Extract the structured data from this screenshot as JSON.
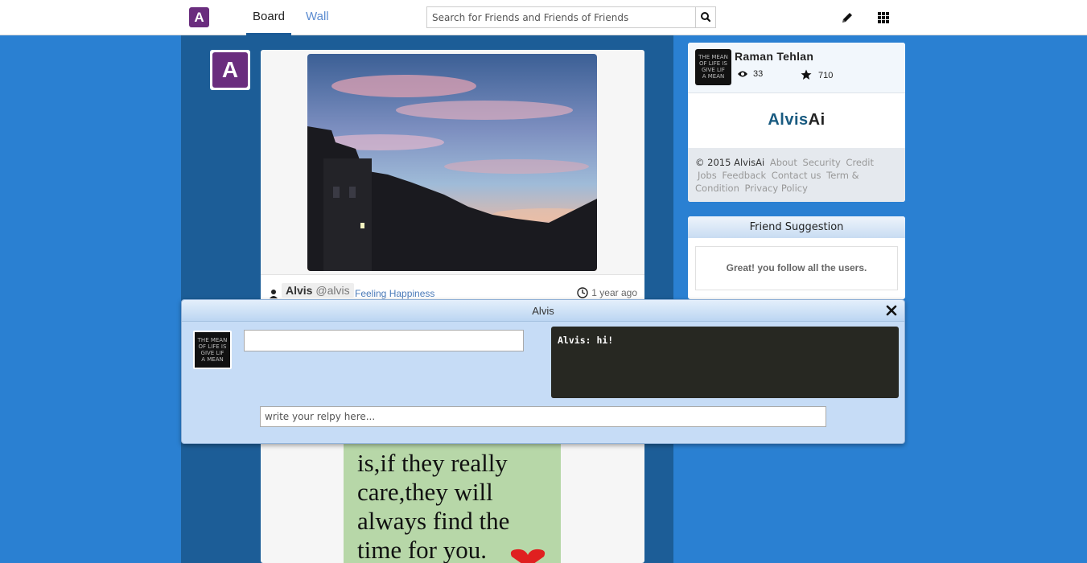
{
  "nav": {
    "logo_letter": "A",
    "tabs": [
      {
        "label": "Board",
        "active": true
      },
      {
        "label": "Wall",
        "active": false
      }
    ],
    "search_placeholder": "Search for Friends and Friends of Friends",
    "icons": [
      "pencil-icon",
      "grid-apps-icon"
    ]
  },
  "sidebar": {
    "avatar_letter": "A"
  },
  "post": {
    "author_name": "Alvis",
    "author_handle": "@alvis",
    "feeling": "Feeling Happiness",
    "time_ago": "1 year ago",
    "quote_lines": [
      "is,if they really",
      "care,they will",
      "always find the",
      "time for you."
    ]
  },
  "profile": {
    "name": "Raman Tehlan",
    "views": "33",
    "stars": "710",
    "thumb_text": [
      "THE MEAN",
      "OF LIFE IS",
      "GIVE LIF",
      "A MEAN"
    ],
    "brand_part1": "Alvis",
    "brand_part2": "Ai",
    "copyright": "© 2015 AlvisAi",
    "links": [
      "About",
      "Security",
      "Credit",
      "Jobs",
      "Feedback",
      "Contact us",
      "Term & Condition",
      "Privacy",
      "Policy"
    ]
  },
  "suggestions": {
    "title": "Friend Suggestion",
    "message": "Great! you follow all the users."
  },
  "chat": {
    "title": "Alvis",
    "log_line": "Alvis: hi!",
    "reply_placeholder": "write your relpy here...",
    "thumb_text": [
      "THE MEAN",
      "OF LIFE IS",
      "GIVE LIF",
      "A MEAN"
    ]
  },
  "colors": {
    "page_bg": "#2a80d2",
    "main_col": "#1c5d97",
    "logo_purple": "#6a2d7e",
    "chat_bg": "#c6dcf6",
    "chat_log_bg": "#272822"
  }
}
